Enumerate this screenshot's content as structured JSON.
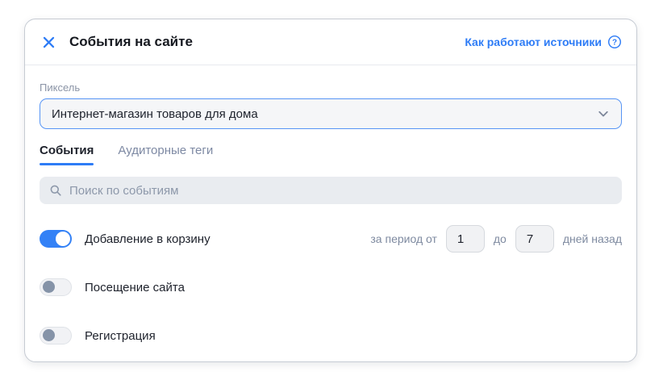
{
  "dialog": {
    "title": "События на сайте",
    "close_icon": "close-icon",
    "help_link": {
      "label": "Как работают источники",
      "icon": "question-circle-icon"
    }
  },
  "pixel": {
    "label": "Пиксель",
    "selected_value": "Интернет-магазин товаров для дома"
  },
  "tabs": [
    {
      "label": "События",
      "active": true
    },
    {
      "label": "Аудиторные теги",
      "active": false
    }
  ],
  "search": {
    "placeholder": "Поиск по событиям",
    "icon": "search-icon"
  },
  "events": {
    "rows": [
      {
        "label": "Добавление в корзину",
        "enabled": true,
        "period": {
          "prefix": "за период от",
          "from": "1",
          "middle": "до",
          "to": "7",
          "suffix": "дней назад"
        }
      },
      {
        "label": "Посещение сайта",
        "enabled": false
      },
      {
        "label": "Регистрация",
        "enabled": false
      }
    ]
  },
  "colors": {
    "accent_blue": "#2e7cf6",
    "toggle_on": "#3381f6",
    "toggle_off_knob": "#8593a8",
    "search_bg": "#e9ecf0",
    "select_border": "#5795f5",
    "muted_text": "#8b94a6",
    "tab_inactive": "#7d89a3"
  }
}
